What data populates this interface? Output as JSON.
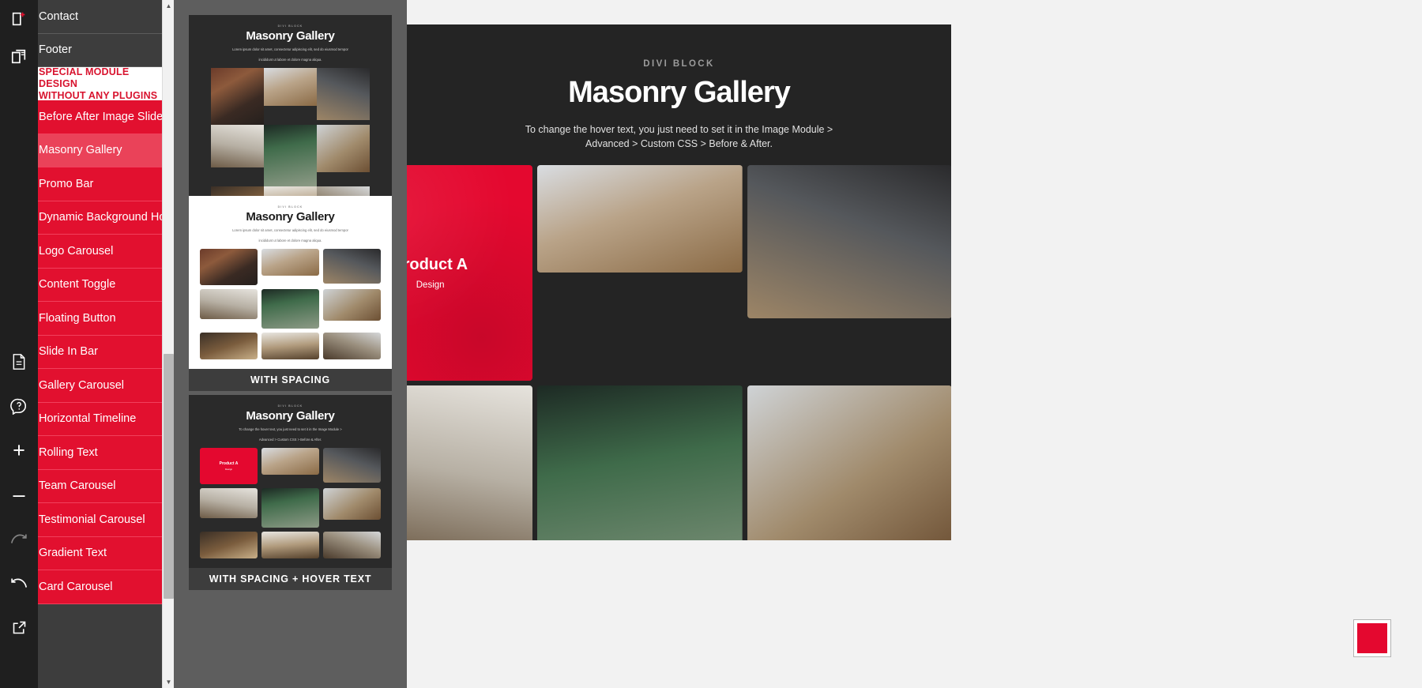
{
  "rail": {
    "icons": [
      {
        "name": "new-page-icon",
        "label": "New Page"
      },
      {
        "name": "duplicate-page-icon",
        "label": "Duplicate Page"
      },
      {
        "name": "document-icon",
        "label": "Document"
      },
      {
        "name": "help-icon",
        "label": "Help"
      },
      {
        "name": "zoom-in-icon",
        "label": "Zoom In",
        "glyph": "+"
      },
      {
        "name": "zoom-out-icon",
        "label": "Zoom Out",
        "glyph": "–"
      },
      {
        "name": "redo-icon",
        "label": "Redo"
      },
      {
        "name": "undo-icon",
        "label": "Undo"
      },
      {
        "name": "open-external-icon",
        "label": "Open External"
      }
    ]
  },
  "sidebar": {
    "items": [
      {
        "label": "Contact",
        "style": "dark"
      },
      {
        "label": "Footer",
        "style": "dark"
      },
      {
        "label": "SPECIAL MODULE DESIGN WITHOUT ANY PLUGINS",
        "style": "heading",
        "line1": "SPECIAL MODULE DESIGN",
        "line2": "WITHOUT ANY PLUGINS"
      },
      {
        "label": "Before After Image Slider",
        "style": "red"
      },
      {
        "label": "Masonry Gallery",
        "style": "red",
        "active": true
      },
      {
        "label": "Promo Bar",
        "style": "red"
      },
      {
        "label": "Dynamic Background Hover",
        "style": "red"
      },
      {
        "label": "Logo Carousel",
        "style": "red"
      },
      {
        "label": "Content Toggle",
        "style": "red"
      },
      {
        "label": "Floating Button",
        "style": "red"
      },
      {
        "label": "Slide In Bar",
        "style": "red"
      },
      {
        "label": "Gallery Carousel",
        "style": "red"
      },
      {
        "label": "Horizontal Timeline",
        "style": "red"
      },
      {
        "label": "Rolling Text",
        "style": "red"
      },
      {
        "label": "Team Carousel",
        "style": "red"
      },
      {
        "label": "Testimonial Carousel",
        "style": "red"
      },
      {
        "label": "Gradient Text",
        "style": "red"
      },
      {
        "label": "Card Carousel",
        "style": "red"
      }
    ]
  },
  "thumbnails": [
    {
      "name": "thumb-no-spacing",
      "eyebrow": "DIVI BLOCK",
      "title": "Masonry Gallery",
      "subtitle_line1": "Lorem ipsum dolor sit amet, consectetur adipiscing elit, sed do eiusmod tempor",
      "subtitle_line2": "incididunt ut labore et dolore magna aliqua.",
      "label": "",
      "theme": "dark",
      "spacing": "none"
    },
    {
      "name": "thumb-with-spacing",
      "eyebrow": "DIVI BLOCK",
      "title": "Masonry Gallery",
      "subtitle_line1": "Lorem ipsum dolor sit amet, consectetur adipiscing elit, sed do eiusmod tempor",
      "subtitle_line2": "incididunt ut labore et dolore magna aliqua.",
      "label": "WITH SPACING",
      "theme": "light",
      "spacing": "gap"
    },
    {
      "name": "thumb-with-spacing-hover-text",
      "eyebrow": "DIVI BLOCK",
      "title": "Masonry Gallery",
      "subtitle_line1": "To change the hover text, you just need to set it in the Image Module >",
      "subtitle_line2": "Advanced > Custom CSS > Before & After.",
      "label": "WITH SPACING + HOVER TEXT",
      "theme": "dark",
      "spacing": "gap"
    }
  ],
  "canvas": {
    "eyebrow": "DIVI BLOCK",
    "title": "Masonry Gallery",
    "subtitle_line1": "To change the hover text, you just need to set it in the Image Module >",
    "subtitle_line2": "Advanced > Custom CSS > Before & After.",
    "hover_tile": {
      "title": "Product A",
      "subtitle": "Design"
    }
  },
  "swatch": {
    "name": "color-swatch",
    "color": "#e4082f"
  },
  "colors": {
    "brand_red": "#e2102f",
    "brand_red_active": "#ea4259",
    "sidebar_dark": "#3d3d3d",
    "canvas_dark": "#242424",
    "panel_gray": "#5e5e5e",
    "rail_dark": "#1f1f1f"
  }
}
